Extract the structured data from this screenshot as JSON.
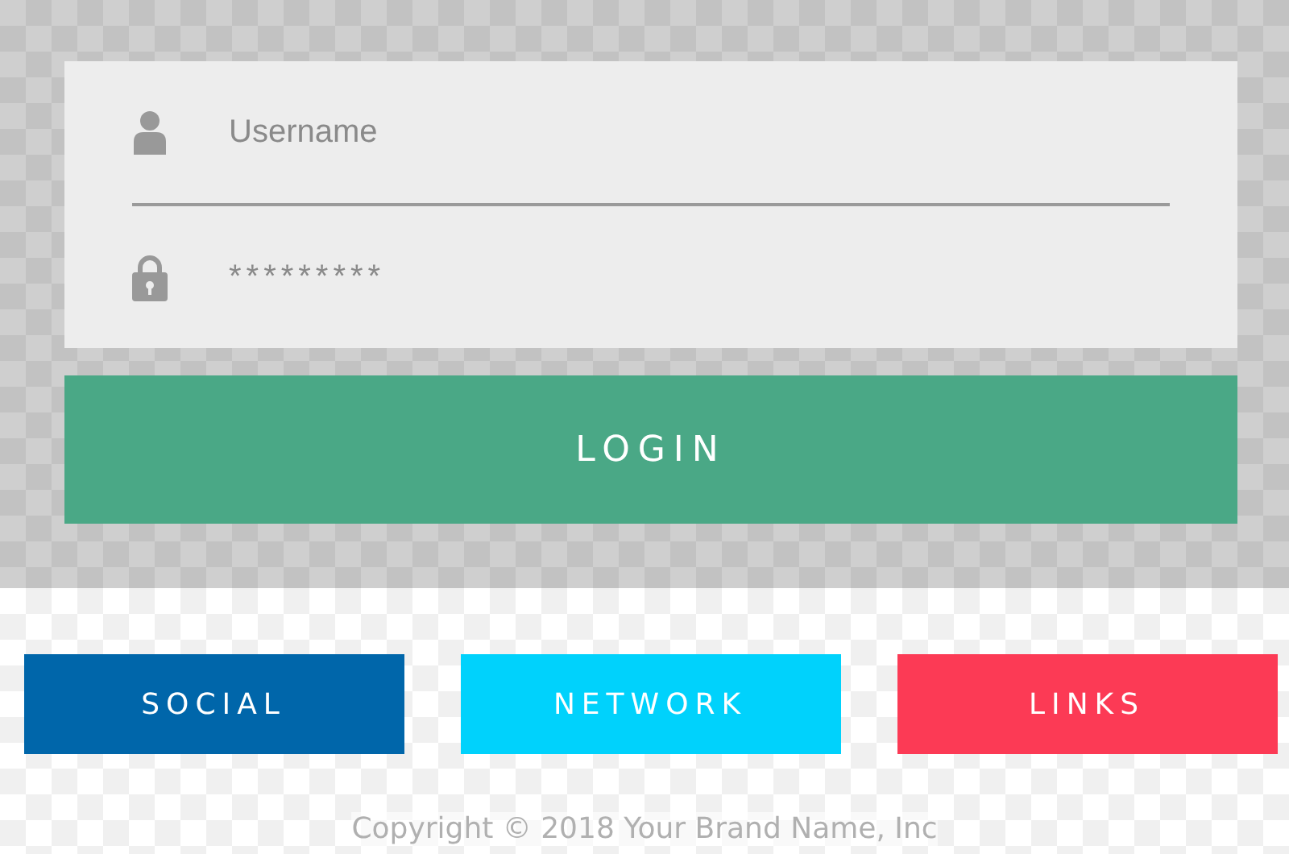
{
  "login_form": {
    "username": {
      "placeholder": "Username"
    },
    "password": {
      "value": "*********"
    },
    "login_button": "LOGIN"
  },
  "link_buttons": [
    {
      "label": "SOCIAL",
      "color": "#0066aa"
    },
    {
      "label": "NETWORK",
      "color": "#00d2fc"
    },
    {
      "label": "LINKS",
      "color": "#fc3a55"
    }
  ],
  "footer": "Copyright © 2018 Your Brand Name, Inc"
}
